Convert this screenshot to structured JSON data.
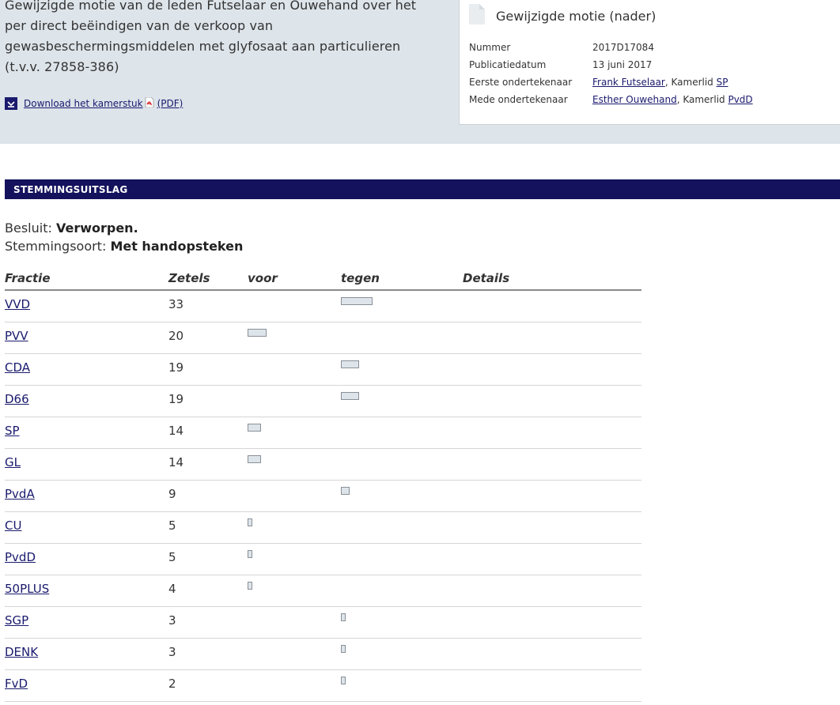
{
  "motion": {
    "text": "Gewijzigde motie van de leden Futselaar en Ouwehand over het\nper direct beëindigen van de verkoop van\ngewasbeschermingsmiddelen met glyfosaat aan particulieren\n(t.v.v. 27858-386)",
    "download_label": "Download het kamerstuk",
    "download_format": "(PDF)"
  },
  "card": {
    "title": "Gewijzigde motie (nader)",
    "rows": [
      {
        "label": "Nummer",
        "value": "2017D17084"
      },
      {
        "label": "Publicatiedatum",
        "value": "13 juni 2017"
      },
      {
        "label": "Eerste ondertekenaar",
        "person": "Frank Futselaar",
        "role": ", Kamerlid ",
        "party": "SP"
      },
      {
        "label": "Mede ondertekenaar",
        "person": "Esther Ouwehand",
        "role": ", Kamerlid ",
        "party": "PvdD"
      }
    ]
  },
  "vote": {
    "header": "STEMMINGSUITSLAG",
    "decision_label": "Besluit:",
    "decision_value": "Verworpen.",
    "type_label": "Stemmingsoort:",
    "type_value": "Met handopsteken",
    "columns": {
      "party": "Fractie",
      "seats": "Zetels",
      "for": "voor",
      "against": "tegen",
      "details": "Details"
    },
    "rows": [
      {
        "party": "VVD",
        "seats": 33,
        "vote": "tegen"
      },
      {
        "party": "PVV",
        "seats": 20,
        "vote": "voor"
      },
      {
        "party": "CDA",
        "seats": 19,
        "vote": "tegen"
      },
      {
        "party": "D66",
        "seats": 19,
        "vote": "tegen"
      },
      {
        "party": "SP",
        "seats": 14,
        "vote": "voor"
      },
      {
        "party": "GL",
        "seats": 14,
        "vote": "voor"
      },
      {
        "party": "PvdA",
        "seats": 9,
        "vote": "tegen"
      },
      {
        "party": "CU",
        "seats": 5,
        "vote": "voor"
      },
      {
        "party": "PvdD",
        "seats": 5,
        "vote": "voor"
      },
      {
        "party": "50PLUS",
        "seats": 4,
        "vote": "voor"
      },
      {
        "party": "SGP",
        "seats": 3,
        "vote": "tegen"
      },
      {
        "party": "DENK",
        "seats": 3,
        "vote": "tegen"
      },
      {
        "party": "FvD",
        "seats": 2,
        "vote": "tegen"
      }
    ]
  },
  "colors": {
    "navy": "#14125c",
    "link": "#1a1a6e",
    "band": "#dde4ea"
  }
}
